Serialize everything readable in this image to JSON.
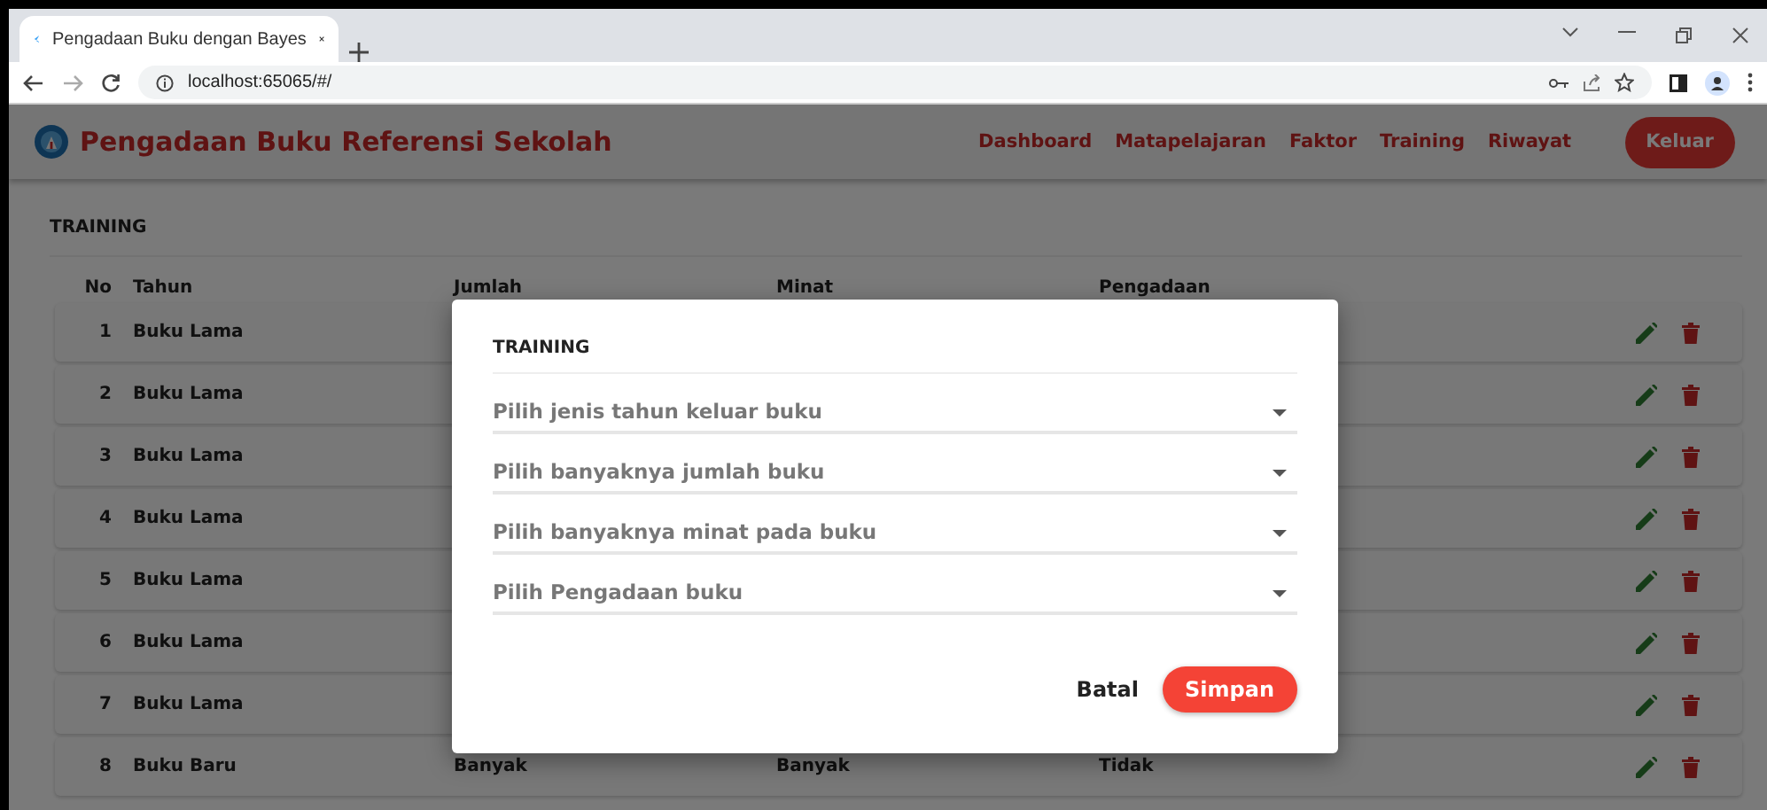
{
  "browser": {
    "tab": {
      "title": "Pengadaan Buku dengan Bayes"
    },
    "address": "localhost:65065/#/"
  },
  "app_bar": {
    "title": "Pengadaan Buku Referensi Sekolah",
    "nav": [
      "Dashboard",
      "Matapelajaran",
      "Faktor",
      "Training",
      "Riwayat"
    ],
    "logout": "Keluar"
  },
  "page": {
    "heading": "TRAINING",
    "table": {
      "columns": [
        "No",
        "Tahun",
        "Jumlah",
        "Minat",
        "Pengadaan"
      ],
      "rows": [
        {
          "cells": [
            "1",
            "Buku Lama"
          ]
        },
        {
          "cells": [
            "2",
            "Buku Lama"
          ]
        },
        {
          "cells": [
            "3",
            "Buku Lama"
          ]
        },
        {
          "cells": [
            "4",
            "Buku Lama"
          ]
        },
        {
          "cells": [
            "5",
            "Buku Lama"
          ]
        },
        {
          "cells": [
            "6",
            "Buku Lama"
          ]
        },
        {
          "cells": [
            "7",
            "Buku Lama"
          ]
        },
        {
          "cells": [
            "8",
            "Buku Baru",
            "Banyak",
            "Banyak",
            "Tidak"
          ]
        }
      ]
    }
  },
  "dialog": {
    "title": "TRAINING",
    "fields": [
      {
        "placeholder": "Pilih jenis tahun keluar buku"
      },
      {
        "placeholder": "Pilih banyaknya jumlah buku"
      },
      {
        "placeholder": "Pilih banyaknya minat pada buku"
      },
      {
        "placeholder": "Pilih Pengadaan buku"
      }
    ],
    "buttons": [
      {
        "label": "Batal",
        "kind": "text"
      },
      {
        "label": "Simpan",
        "kind": "filled"
      }
    ]
  }
}
